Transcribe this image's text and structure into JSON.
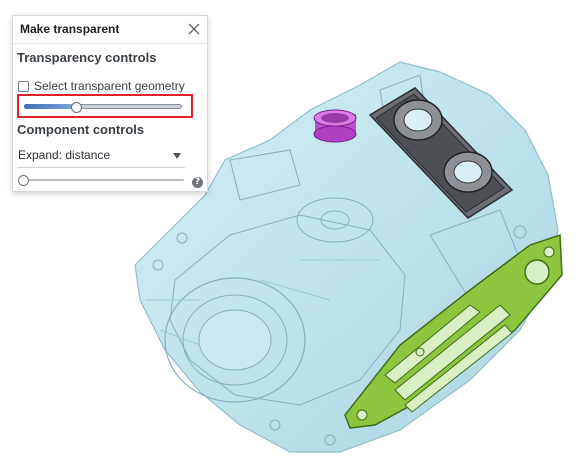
{
  "panel": {
    "title": "Make transparent",
    "close_icon": "close-icon",
    "transparency_section_title": "Transparency controls",
    "select_geometry_label": "Select transparent geometry",
    "select_geometry_checked": false,
    "transparency_slider_value": 0.33,
    "component_section_title": "Component controls",
    "expand_dropdown_value": "Expand: distance",
    "expand_slider_value": 0.0,
    "help_icon": "help-icon",
    "help_glyph": "?"
  },
  "viewport": {
    "model_colors": {
      "housing": "#a9dbe6",
      "housing_edge": "#7fb3c0",
      "plate": "#8cc63f",
      "plate_edge": "#3f6e18",
      "block": "#5a5c60",
      "cap": "#c04ad0"
    }
  }
}
